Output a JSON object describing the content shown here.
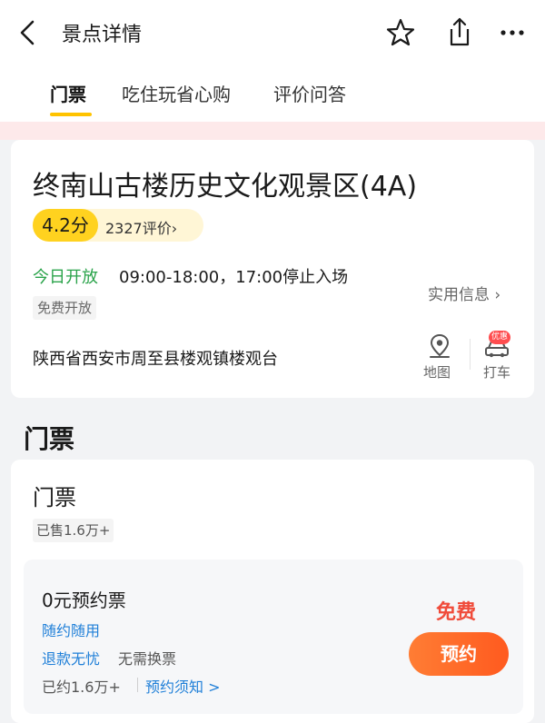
{
  "header": {
    "title": "景点详情"
  },
  "tabs": [
    {
      "label": "门票"
    },
    {
      "label": "吃住玩省心购"
    },
    {
      "label": "评价问答"
    }
  ],
  "scenic": {
    "title": "终南山古楼历史文化观景区(4A)",
    "score": "4.2分",
    "review_count": "2327评价›",
    "open_status": "今日开放",
    "open_hours": "09:00-18:00，17:00停止入场",
    "free_tag": "免费开放",
    "practical_info": "实用信息 ›",
    "address": "陕西省西安市周至县楼观镇楼观台",
    "map_label": "地图",
    "taxi_label": "打车",
    "promo_badge": "优惠"
  },
  "tickets": {
    "section_title": "门票",
    "group_title": "门票",
    "sold": "已售1.6万+",
    "item": {
      "name": "0元预约票",
      "tag_flex": "随约随用",
      "tag_refund": "退款无忧",
      "tag_no_exchange": "无需换票",
      "booked": "已约1.6万+",
      "notice_link": "预约须知 >",
      "price": "免费",
      "button_label": "预约"
    }
  },
  "colors": {
    "accent_yellow": "#ffc300",
    "open_green": "#2aa34a",
    "link_blue": "#1f7fd8",
    "price_red": "#f04b3a",
    "button_orange": "#ff6a2a"
  }
}
